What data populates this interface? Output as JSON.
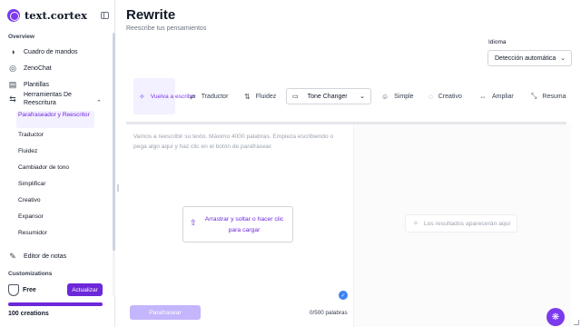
{
  "brand": {
    "name": "text.cortex"
  },
  "sidebar": {
    "overview_label": "Overview",
    "items": [
      {
        "label": "Cuadro de mandos",
        "icon": "dashboard-icon"
      },
      {
        "label": "ZenoChat",
        "icon": "chat-icon"
      },
      {
        "label": "Plantillas",
        "icon": "templates-icon"
      },
      {
        "label": "Herramientas De Reescritura",
        "icon": "rewrite-tools-icon"
      }
    ],
    "sub_items": [
      {
        "label": "Parafraseador y Reescritor",
        "active": true
      },
      {
        "label": "Traductor"
      },
      {
        "label": "Fluidez"
      },
      {
        "label": "Cambiador de tono"
      },
      {
        "label": "Simplificar"
      },
      {
        "label": "Creativo"
      },
      {
        "label": "Expansor"
      },
      {
        "label": "Resumidor"
      }
    ],
    "notes_editor": "Editor de notas",
    "customizations_label": "Customizations",
    "plan": "Free",
    "upgrade_label": "Actualizar",
    "credits_text": "100 creations",
    "credits_fraction": 1.0
  },
  "main": {
    "title": "Rewrite",
    "subtitle": "Reescribe tus pensamientos",
    "language_label": "Idioma",
    "language_value": "Detección automática",
    "tools": [
      {
        "label": "Vuelva a escribir",
        "icon": "sparkle-icon",
        "active": true
      },
      {
        "label": "Traductor",
        "icon": "translate-icon"
      },
      {
        "label": "Fluidez",
        "icon": "fluency-icon"
      },
      {
        "label": "Tone Changer",
        "icon": "tone-icon",
        "dropdown": true
      },
      {
        "label": "Simple",
        "icon": "simple-icon"
      },
      {
        "label": "Creativo",
        "icon": "creative-icon"
      },
      {
        "label": "Ampliar",
        "icon": "expand-icon"
      },
      {
        "label": "Resuma",
        "icon": "summarize-icon"
      }
    ],
    "editor_placeholder": "Vamos a reescribir su texto. Máximo 4000 palabras. Empieza escribiendo o pega algo aquí y haz clic en el botón de parafrasear.",
    "drop_text": "Arrastrar y soltar o hacer clic para cargar",
    "paraphrase_button": "Parafrasear",
    "word_counter": "0/500 palabras",
    "results_placeholder": "Los resultados aparecerán aquí"
  },
  "colors": {
    "accent": "#6d28d9",
    "accent_light": "#c4b5fd",
    "active_bg": "#f3f0ff"
  }
}
